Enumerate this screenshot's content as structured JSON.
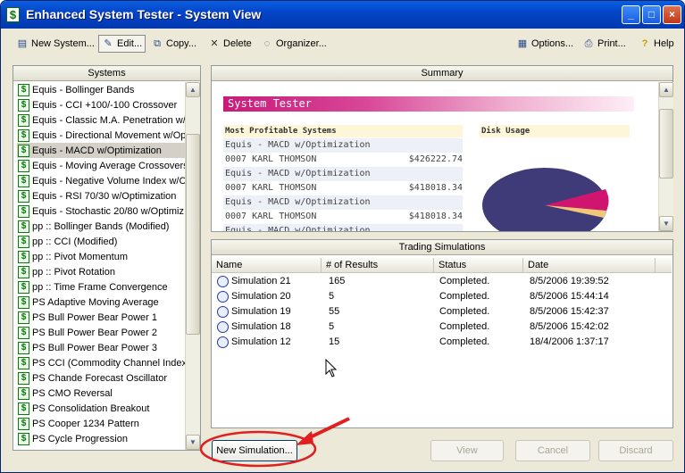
{
  "window": {
    "title": "Enhanced System Tester - System View",
    "app_icon": "$"
  },
  "toolbar": {
    "new_system": "New System...",
    "edit": "Edit...",
    "copy": "Copy...",
    "delete": "Delete",
    "organizer": "Organizer...",
    "options": "Options...",
    "print": "Print...",
    "help": "Help"
  },
  "systems": {
    "header": "Systems",
    "items": [
      {
        "label": "Equis - Bollinger Bands"
      },
      {
        "label": "Equis - CCI +100/-100 Crossover"
      },
      {
        "label": "Equis - Classic M.A. Penetration  w/O"
      },
      {
        "label": "Equis - Directional Movement  w/Op"
      },
      {
        "label": "Equis - MACD  w/Optimization"
      },
      {
        "label": "Equis - Moving Average Crossovers"
      },
      {
        "label": "Equis - Negative Volume Index  w/C"
      },
      {
        "label": "Equis - RSI 70/30 w/Optimization"
      },
      {
        "label": "Equis - Stochastic 20/80  w/Optimiz"
      },
      {
        "label": "pp :: Bollinger Bands (Modified)"
      },
      {
        "label": "pp :: CCI (Modified)"
      },
      {
        "label": "pp :: Pivot Momentum"
      },
      {
        "label": "pp :: Pivot Rotation"
      },
      {
        "label": "pp :: Time Frame Convergence"
      },
      {
        "label": "PS Adaptive Moving Average"
      },
      {
        "label": "PS Bull Power Bear Power 1"
      },
      {
        "label": "PS Bull Power Bear Power 2"
      },
      {
        "label": "PS Bull Power Bear Power 3"
      },
      {
        "label": "PS CCI (Commodity Channel Index)"
      },
      {
        "label": "PS Chande Forecast Oscillator"
      },
      {
        "label": "PS CMO Reversal"
      },
      {
        "label": "PS Consolidation Breakout"
      },
      {
        "label": "PS Cooper 1234 Pattern"
      },
      {
        "label": "PS Cycle Progression"
      }
    ],
    "selected_index": 4
  },
  "summary": {
    "header": "Summary",
    "banner": "System Tester",
    "most_profitable_header": "Most Profitable Systems",
    "disk_usage_header": "Disk Usage",
    "entries": [
      {
        "system": "Equis - MACD w/Optimization",
        "id": "0007 KARL THOMSON",
        "amount": "$426222.74"
      },
      {
        "system": "Equis - MACD w/Optimization",
        "id": "0007 KARL THOMSON",
        "amount": "$418018.34"
      },
      {
        "system": "Equis - MACD w/Optimization",
        "id": "0007 KARL THOMSON",
        "amount": "$418018.34"
      },
      {
        "system": "Equis - MACD w/Optimization",
        "id": "",
        "amount": ""
      }
    ],
    "pie_colors": {
      "main": "#3f3a78",
      "slice_a": "#d01570",
      "slice_b": "#f0c878"
    }
  },
  "simulations": {
    "header": "Trading Simulations",
    "columns": [
      "Name",
      "# of Results",
      "Status",
      "Date"
    ],
    "rows": [
      {
        "name": "Simulation 21",
        "results": "165",
        "status": "Completed.",
        "date": "8/5/2006 19:39:52"
      },
      {
        "name": "Simulation 20",
        "results": "5",
        "status": "Completed.",
        "date": "8/5/2006 15:44:14"
      },
      {
        "name": "Simulation 19",
        "results": "55",
        "status": "Completed.",
        "date": "8/5/2006 15:42:37"
      },
      {
        "name": "Simulation 18",
        "results": "5",
        "status": "Completed.",
        "date": "8/5/2006 15:42:02"
      },
      {
        "name": "Simulation 12",
        "results": "15",
        "status": "Completed.",
        "date": "18/4/2006 1:37:17"
      }
    ]
  },
  "buttons": {
    "new_simulation": "New Simulation...",
    "view": "View",
    "cancel": "Cancel",
    "discard": "Discard"
  },
  "colors": {
    "accent": "#0a5fe0",
    "highlight_circle": "#e02020"
  }
}
